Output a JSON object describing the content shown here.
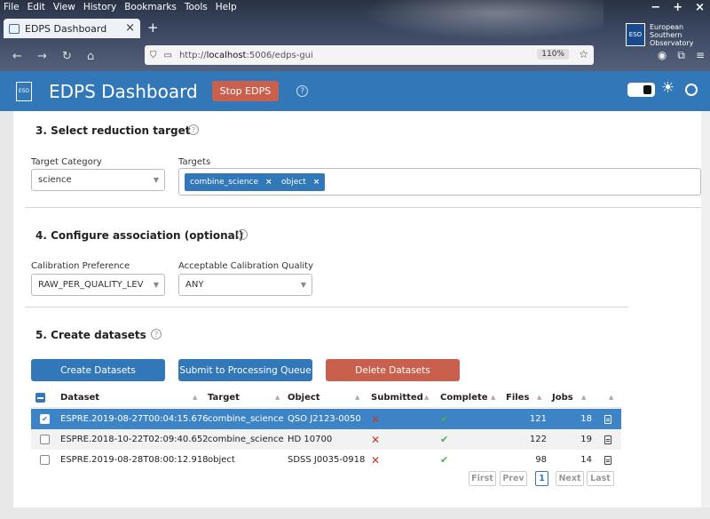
{
  "browser": {
    "menu": [
      "File",
      "Edit",
      "View",
      "History",
      "Bookmarks",
      "Tools",
      "Help"
    ],
    "window_controls": [
      "−",
      "+",
      "×"
    ],
    "tab_title": "EDPS Dashboard",
    "tab_close": "×",
    "new_tab": "+",
    "url_prefix": "http://",
    "url_host": "localhost",
    "url_rest": ":5006/edps-gui",
    "zoom": "110%",
    "org_logo_text": [
      "European",
      "Southern",
      "Observatory"
    ]
  },
  "app": {
    "title": "EDPS Dashboard",
    "stop_button": "Stop EDPS",
    "help": "?"
  },
  "section3": {
    "title": "3. Select reduction target",
    "category_label": "Target Category",
    "category_value": "science",
    "targets_label": "Targets",
    "targets": [
      "combine_science",
      "object"
    ],
    "remove": "×"
  },
  "section4": {
    "title": "4. Configure association (optional)",
    "calib_pref_label": "Calibration Preference",
    "calib_pref_value": "RAW_PER_QUALITY_LEV",
    "calib_quality_label": "Acceptable Calibration Quality",
    "calib_quality_value": "ANY"
  },
  "section5": {
    "title": "5. Create datasets",
    "buttons": {
      "create": "Create Datasets",
      "submit": "Submit to Processing Queue",
      "delete": "Delete Datasets"
    },
    "columns": [
      "Dataset",
      "Target",
      "Object",
      "Submitted",
      "Complete",
      "Files",
      "Jobs"
    ],
    "rows": [
      {
        "dataset": "ESPRE.2019-08-27T00:04:15.676",
        "target": "combine_science",
        "object": "QSO J2123-0050",
        "submitted": "✕",
        "complete": "✔",
        "files": "121",
        "jobs": "18",
        "selected": true
      },
      {
        "dataset": "ESPRE.2018-10-22T02:09:40.652",
        "target": "combine_science",
        "object": "HD 10700",
        "submitted": "✕",
        "complete": "✔",
        "files": "122",
        "jobs": "19",
        "selected": false
      },
      {
        "dataset": "ESPRE.2019-08-28T08:00:12.918",
        "target": "object",
        "object": "SDSS J0035-0918",
        "submitted": "✕",
        "complete": "✔",
        "files": "98",
        "jobs": "14",
        "selected": false
      }
    ],
    "pager": {
      "first": "First",
      "prev": "Prev",
      "page": "1",
      "next": "Next",
      "last": "Last"
    }
  },
  "colors": {
    "primary": "#3277b8",
    "danger": "#c9604e",
    "selected_row": "#3d84c6"
  }
}
